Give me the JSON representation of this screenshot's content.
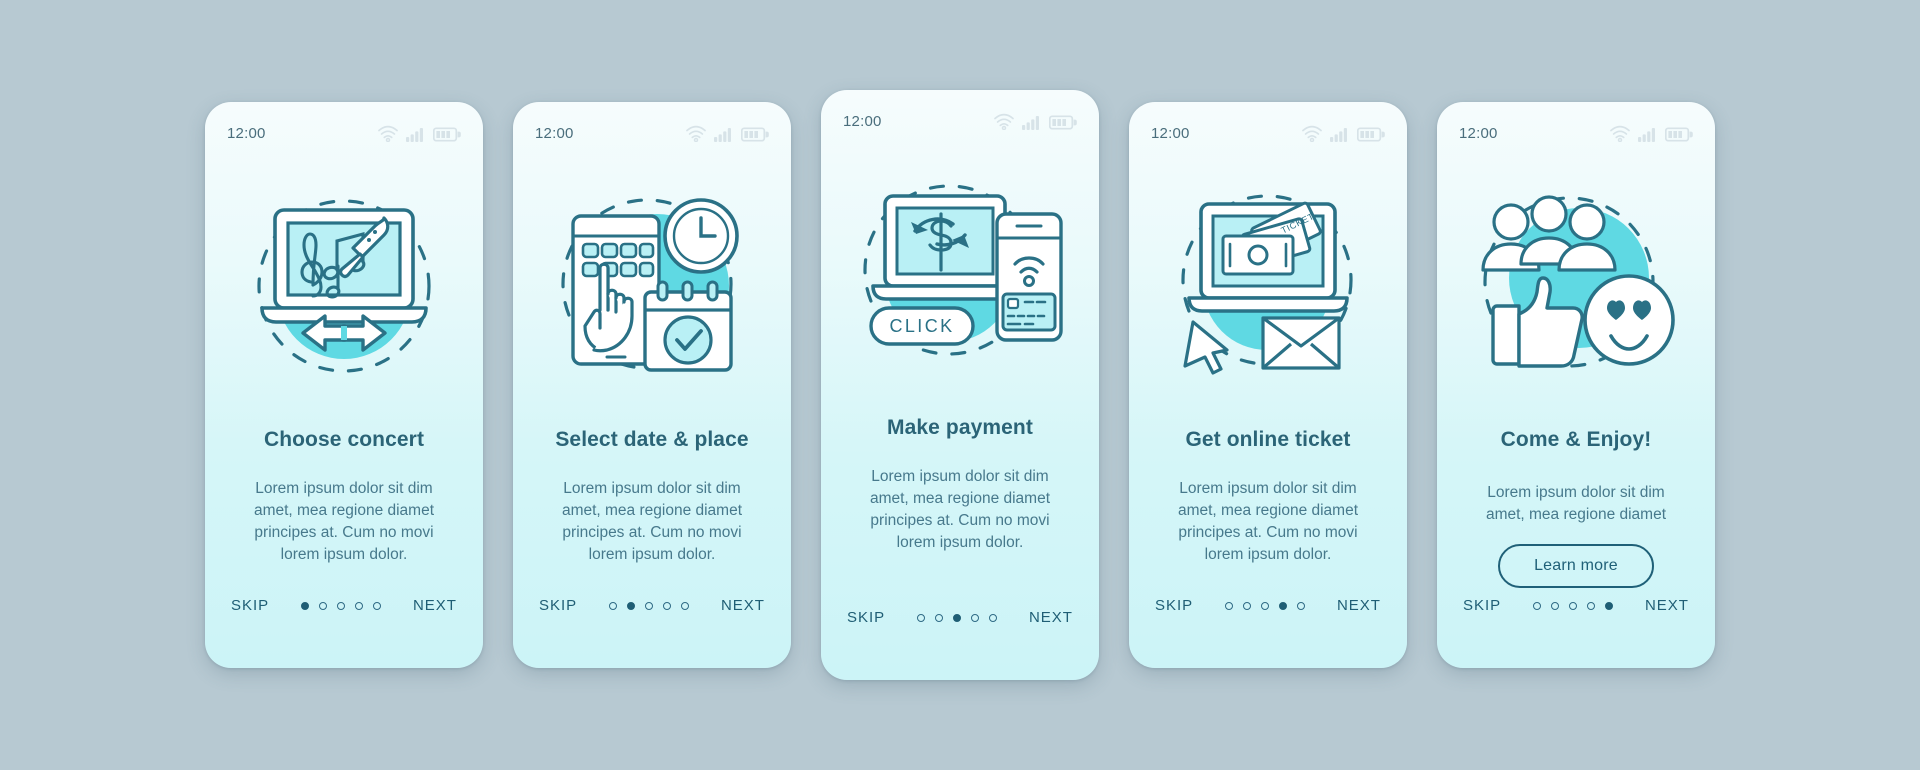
{
  "app": {
    "background_color": "#b7c9d2",
    "accent_color": "#5fd9e3",
    "line_color": "#2a7186",
    "text_dark": "#2b6477",
    "text_body": "#47798c"
  },
  "status_bar": {
    "time": "12:00",
    "icons": [
      "wifi-icon",
      "signal-icon",
      "battery-icon"
    ]
  },
  "nav": {
    "skip_label": "SKIP",
    "next_label": "NEXT",
    "total_steps": 5
  },
  "screens": [
    {
      "id": "choose-concert",
      "illustration": "laptop-music-notes-microphone-arrows",
      "title": "Choose concert",
      "description": "Lorem ipsum dolor sit dim amet, mea regione diamet principes at. Cum no movi lorem ipsum dolor.",
      "active_dot": 1,
      "cta": null
    },
    {
      "id": "select-date-place",
      "illustration": "phone-grid-hand-clock-calendar-check",
      "title": "Select date & place",
      "description": "Lorem ipsum dolor sit dim amet, mea regione diamet principes at. Cum no movi lorem ipsum dolor.",
      "active_dot": 2,
      "cta": null
    },
    {
      "id": "make-payment",
      "illustration": "laptop-dollar-refresh-phone-nfc-card-click",
      "illustration_label": "CLICK",
      "title": "Make payment",
      "description": "Lorem ipsum dolor sit dim amet, mea regione diamet principes at. Cum no movi lorem ipsum dolor.",
      "active_dot": 3,
      "cta": null
    },
    {
      "id": "get-online-ticket",
      "illustration": "laptop-tickets-cursor-envelope",
      "illustration_label": "TICKET",
      "title": "Get online ticket",
      "description": "Lorem ipsum dolor sit dim amet, mea regione diamet principes at. Cum no movi lorem ipsum dolor.",
      "active_dot": 4,
      "cta": null
    },
    {
      "id": "come-and-enjoy",
      "illustration": "people-thumbsup-smiley-hearts",
      "title": "Come & Enjoy!",
      "description": "Lorem ipsum dolor sit dim amet, mea regione diamet",
      "active_dot": 5,
      "cta": "Learn more"
    }
  ]
}
